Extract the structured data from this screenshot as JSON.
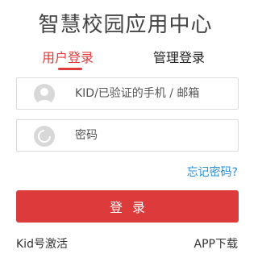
{
  "title": "智慧校园应用中心",
  "tabs": {
    "user_login": "用户登录",
    "admin_login": "管理登录"
  },
  "form": {
    "kid_placeholder": "KID/已验证的手机 / 邮箱",
    "password_placeholder": "密码",
    "user_icon": "user-icon",
    "lock_icon": "lock-icon"
  },
  "links": {
    "forgot_password": "忘记密码?",
    "kid_activate": "Kid号激活",
    "app_download": "APP下载"
  },
  "login_button": "登录",
  "colors": {
    "accent": "#dd3b3b",
    "link": "#2a8fd8",
    "icon_bg": "#d8d8d8"
  }
}
